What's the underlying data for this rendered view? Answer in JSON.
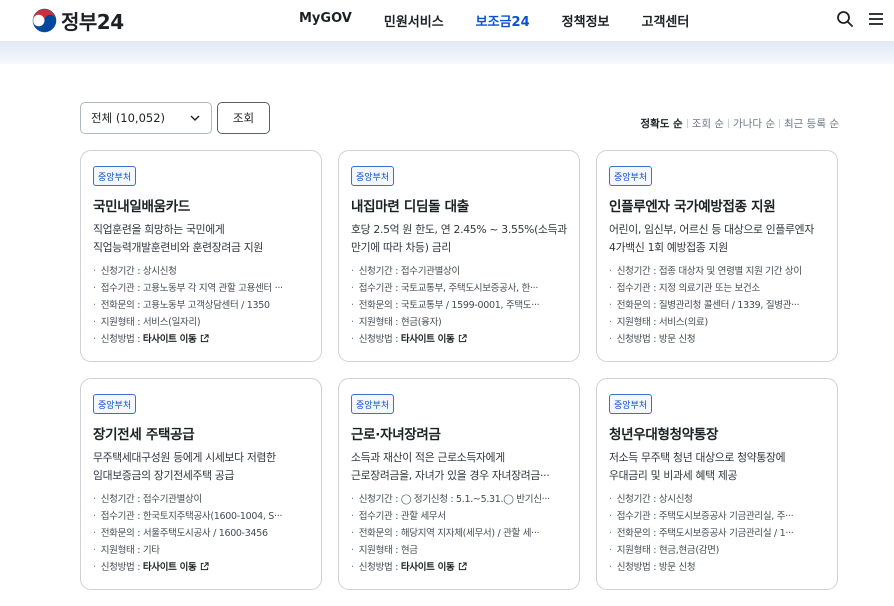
{
  "header": {
    "logo_text": "정부24",
    "nav": [
      {
        "label": "MyGOV",
        "active": false
      },
      {
        "label": "민원서비스",
        "active": false
      },
      {
        "label": "보조금24",
        "active": true
      },
      {
        "label": "정책정보",
        "active": false
      },
      {
        "label": "고객센터",
        "active": false
      }
    ],
    "icons": [
      "search-icon",
      "menu-icon"
    ],
    "active_color": "#0b50d0"
  },
  "filter": {
    "select_value": "전체 (10,052)",
    "search_button": "조회"
  },
  "sort": [
    "정확도 순",
    "조회 순",
    "가나다 순",
    "최근 등록 순"
  ],
  "cards": [
    {
      "badge": "중앙부처",
      "title": "국민내일배움카드",
      "desc": [
        "직업훈련을 희망하는 국민에게",
        "직업능력개발훈련비와 훈련장려금 지원"
      ],
      "info": [
        {
          "label": "신청기간 : ",
          "value": "상시신청"
        },
        {
          "label": "접수기관 : ",
          "value": "고용노동부 각 지역 관할 고용센터 ···"
        },
        {
          "label": "전화문의 : ",
          "value": "고용노동부 고객상담센터 / 1350"
        },
        {
          "label": "지원형태 : ",
          "value": "서비스(일자리)"
        },
        {
          "label": "신청방법 : ",
          "value": "타사이트 이동",
          "link": true
        }
      ]
    },
    {
      "badge": "중앙부처",
      "title": "내집마련 디딤돌 대출",
      "desc": [
        "호당 2.5억 원 한도, 연 2.45% ~ 3.55%(소득과",
        "만기에 따라 차등) 금리"
      ],
      "info": [
        {
          "label": "신청기간 : ",
          "value": "접수기관별상이"
        },
        {
          "label": "접수기관 : ",
          "value": "국토교통부, 주택도시보증공사, 한···"
        },
        {
          "label": "전화문의 : ",
          "value": "국토교통부 / 1599-0001, 주택도···"
        },
        {
          "label": "지원형태 : ",
          "value": "현금(융자)"
        },
        {
          "label": "신청방법 : ",
          "value": "타사이트 이동",
          "link": true
        }
      ]
    },
    {
      "badge": "중앙부처",
      "title": "인플루엔자 국가예방접종 지원",
      "desc": [
        "어린이, 임신부, 어르신 등 대상으로 인플루엔자",
        "4가백신 1회 예방접종 지원"
      ],
      "info": [
        {
          "label": "신청기간 : ",
          "value": "접종 대상자 및 연령별 지원 기간 상이"
        },
        {
          "label": "접수기관 : ",
          "value": "지정 의료기관 또는 보건소"
        },
        {
          "label": "전화문의 : ",
          "value": "질병관리청 콜센터 / 1339, 질병관···"
        },
        {
          "label": "지원형태 : ",
          "value": "서비스(의료)"
        },
        {
          "label": "신청방법 : ",
          "value": "방문 신청"
        }
      ]
    },
    {
      "badge": "중앙부처",
      "title": "장기전세 주택공급",
      "desc": [
        "무주택세대구성원 등에게 시세보다 저렴한",
        "임대보증금의 장기전세주택 공급"
      ],
      "info": [
        {
          "label": "신청기간 : ",
          "value": "접수기관별상이"
        },
        {
          "label": "접수기관 : ",
          "value": "한국토지주택공사(1600-1004, S···"
        },
        {
          "label": "전화문의 : ",
          "value": "서울주택도시공사 / 1600-3456"
        },
        {
          "label": "지원형태 : ",
          "value": "기타"
        },
        {
          "label": "신청방법 : ",
          "value": "타사이트 이동",
          "link": true
        }
      ]
    },
    {
      "badge": "중앙부처",
      "title": "근로·자녀장려금",
      "desc": [
        "소득과 재산이 적은 근로소득자에게",
        "근로장려금을, 자녀가 있을 경우 자녀장려금···"
      ],
      "info": [
        {
          "label": "신청기간 : ",
          "value": "◯ 정기신청 : 5.1.~5.31.◯ 반기신···"
        },
        {
          "label": "접수기관 : ",
          "value": "관할 세무서"
        },
        {
          "label": "전화문의 : ",
          "value": "해당지역 지자체(세무서) / 관할 세···"
        },
        {
          "label": "지원형태 : ",
          "value": "현금"
        },
        {
          "label": "신청방법 : ",
          "value": "타사이트 이동",
          "link": true
        }
      ]
    },
    {
      "badge": "중앙부처",
      "title": "청년우대형청약통장",
      "desc": [
        "저소득 무주택 청년 대상으로 청약통장에",
        "우대금리 및 비과세 혜택 제공"
      ],
      "info": [
        {
          "label": "신청기간 : ",
          "value": "상시신청"
        },
        {
          "label": "접수기관 : ",
          "value": "주택도시보증공사 기금관리실, 주···"
        },
        {
          "label": "전화문의 : ",
          "value": "주택도시보증공사 기금관리실 / 1···"
        },
        {
          "label": "지원형태 : ",
          "value": "현금,현금(감면)"
        },
        {
          "label": "신청방법 : ",
          "value": "방문 신청"
        }
      ]
    }
  ]
}
